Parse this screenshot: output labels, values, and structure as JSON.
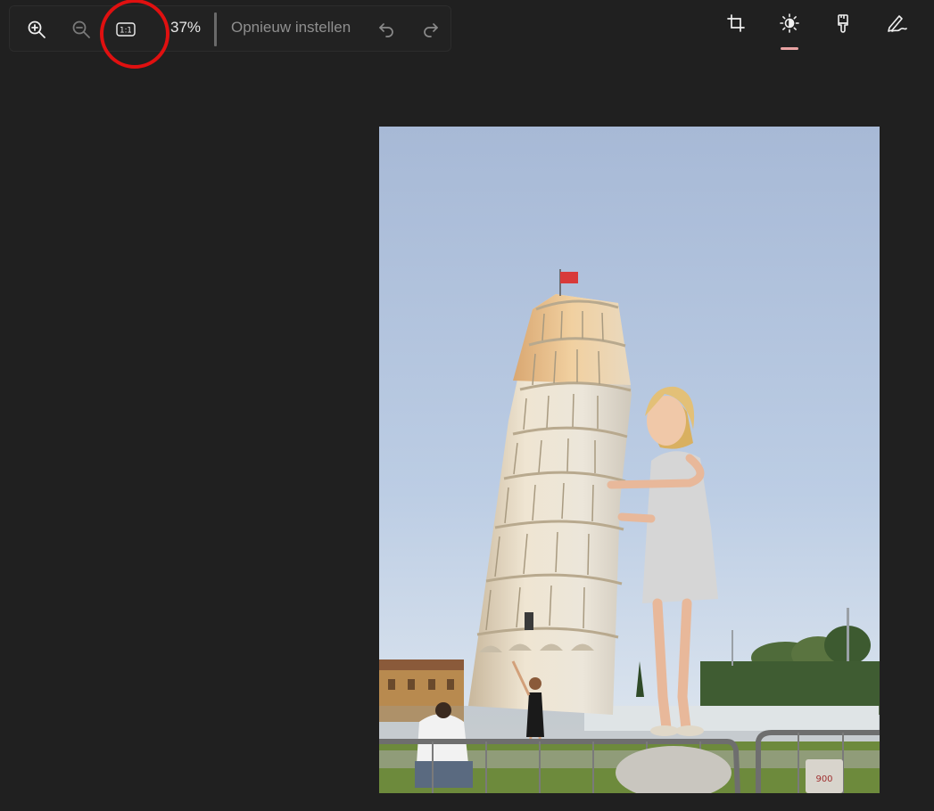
{
  "toolbar": {
    "zoom_in_icon": "zoom-in-icon",
    "zoom_out_icon": "zoom-out-icon",
    "actual_size_label": "1:1",
    "zoom_level": "37%",
    "reset_label": "Opnieuw instellen",
    "undo_icon": "undo-icon",
    "redo_icon": "redo-icon"
  },
  "tools": [
    {
      "name": "crop",
      "icon": "crop-icon",
      "active": false
    },
    {
      "name": "adjust",
      "icon": "brightness-icon",
      "active": true
    },
    {
      "name": "filter",
      "icon": "brush-icon",
      "active": false
    },
    {
      "name": "markup",
      "icon": "pen-icon",
      "active": false
    }
  ],
  "annotation": {
    "color": "#e01010",
    "target": "actual-size-button"
  },
  "colors": {
    "background": "#202020",
    "active_underline": "#e8a2a2",
    "text": "#e8e8e8",
    "muted_text": "#8f8f8f"
  },
  "photo": {
    "sign_text": "900"
  }
}
